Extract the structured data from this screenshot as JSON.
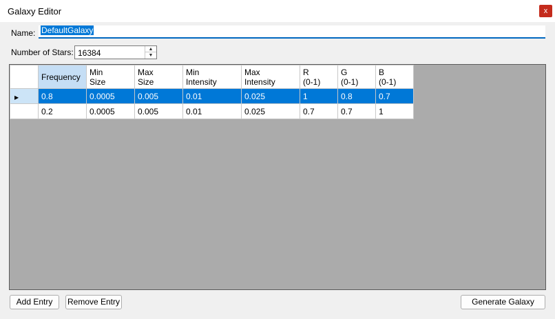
{
  "window": {
    "title": "Galaxy Editor",
    "close_label": "x"
  },
  "form": {
    "name_label": "Name:",
    "name_value": "DefaultGalaxy",
    "stars_label": "Number of Stars:",
    "stars_value": "16384"
  },
  "grid": {
    "columns": [
      {
        "line1": "Frequency",
        "line2": ""
      },
      {
        "line1": "Min",
        "line2": "Size"
      },
      {
        "line1": "Max",
        "line2": "Size"
      },
      {
        "line1": "Min",
        "line2": "Intensity"
      },
      {
        "line1": "Max",
        "line2": "Intensity"
      },
      {
        "line1": "R",
        "line2": "(0-1)"
      },
      {
        "line1": "G",
        "line2": "(0-1)"
      },
      {
        "line1": "B",
        "line2": "(0-1)"
      }
    ],
    "rows": [
      [
        "0.8",
        "0.0005",
        "0.005",
        "0.01",
        "0.025",
        "1",
        "0.8",
        "0.7"
      ],
      [
        "0.2",
        "0.0005",
        "0.005",
        "0.01",
        "0.025",
        "0.7",
        "0.7",
        "1"
      ]
    ],
    "selected_row": 0
  },
  "buttons": {
    "add": "Add Entry",
    "remove": "Remove Entry",
    "generate": "Generate Galaxy"
  },
  "icons": {
    "row_pointer": "triangle-right-icon",
    "spin_up": "caret-up-icon",
    "spin_down": "caret-down-icon"
  },
  "colors": {
    "selection": "#0078d7",
    "close": "#c42b1c",
    "grid_bg": "#ababab"
  }
}
